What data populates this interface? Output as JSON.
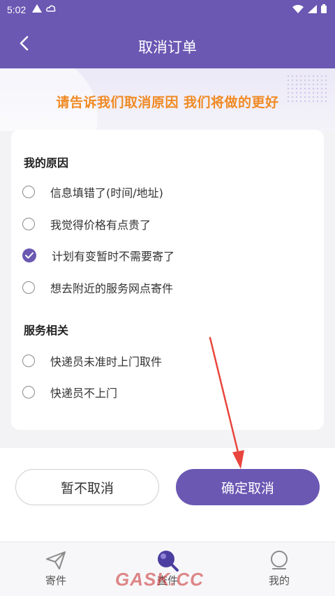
{
  "status_bar": {
    "time": "5:02"
  },
  "header": {
    "title": "取消订单"
  },
  "banner": {
    "text": "请告诉我们取消原因  我们将做的更好"
  },
  "sections": [
    {
      "title": "我的原因",
      "options": [
        {
          "label": "信息填错了(时间/地址)",
          "checked": false
        },
        {
          "label": "我觉得价格有点贵了",
          "checked": false
        },
        {
          "label": "计划有变暂时不需要寄了",
          "checked": true
        },
        {
          "label": "想去附近的服务网点寄件",
          "checked": false
        }
      ]
    },
    {
      "title": "服务相关",
      "options": [
        {
          "label": "快递员未准时上门取件",
          "checked": false
        },
        {
          "label": "快递员不上门",
          "checked": false
        }
      ]
    }
  ],
  "buttons": {
    "cancel": "暂不取消",
    "confirm": "确定取消"
  },
  "tabs": [
    {
      "label": "寄件",
      "icon": "send-icon"
    },
    {
      "label": "查件",
      "icon": "search-icon"
    },
    {
      "label": "我的",
      "icon": "profile-icon"
    }
  ],
  "watermark": "GASK.CC",
  "colors": {
    "primary": "#6a58b3",
    "accent": "#f08a24",
    "annotation": "#e8453c"
  }
}
